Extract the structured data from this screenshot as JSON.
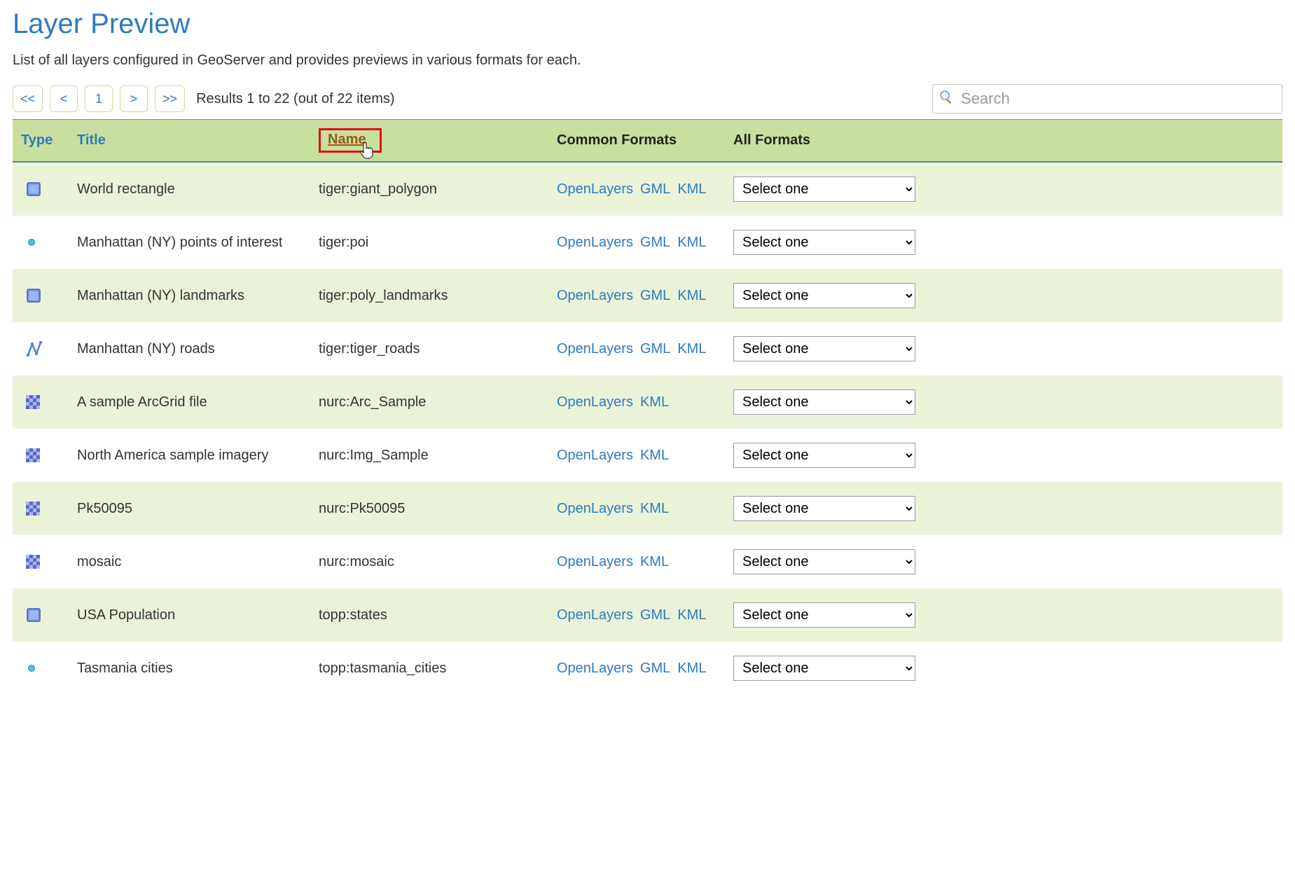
{
  "page": {
    "title": "Layer Preview",
    "subtitle": "List of all layers configured in GeoServer and provides previews in various formats for each."
  },
  "pager": {
    "first": "<<",
    "prev": "<",
    "current": "1",
    "next": ">",
    "last": ">>",
    "results_text": "Results 1 to 22 (out of 22 items)"
  },
  "search": {
    "placeholder": "Search"
  },
  "columns": {
    "type": "Type",
    "title": "Title",
    "name": "Name",
    "common": "Common Formats",
    "all": "All Formats"
  },
  "format_labels": {
    "openlayers": "OpenLayers",
    "gml": "GML",
    "kml": "KML"
  },
  "select_placeholder": "Select one",
  "rows": [
    {
      "icon": "polygon",
      "title": "World rectangle",
      "name": "tiger:giant_polygon",
      "has_gml": true
    },
    {
      "icon": "point",
      "title": "Manhattan (NY) points of interest",
      "name": "tiger:poi",
      "has_gml": true
    },
    {
      "icon": "polygon",
      "title": "Manhattan (NY) landmarks",
      "name": "tiger:poly_landmarks",
      "has_gml": true
    },
    {
      "icon": "line",
      "title": "Manhattan (NY) roads",
      "name": "tiger:tiger_roads",
      "has_gml": true
    },
    {
      "icon": "raster",
      "title": "A sample ArcGrid file",
      "name": "nurc:Arc_Sample",
      "has_gml": false
    },
    {
      "icon": "raster",
      "title": "North America sample imagery",
      "name": "nurc:Img_Sample",
      "has_gml": false
    },
    {
      "icon": "raster",
      "title": "Pk50095",
      "name": "nurc:Pk50095",
      "has_gml": false
    },
    {
      "icon": "raster",
      "title": "mosaic",
      "name": "nurc:mosaic",
      "has_gml": false
    },
    {
      "icon": "polygon",
      "title": "USA Population",
      "name": "topp:states",
      "has_gml": true
    },
    {
      "icon": "point",
      "title": "Tasmania cities",
      "name": "topp:tasmania_cities",
      "has_gml": true
    }
  ]
}
